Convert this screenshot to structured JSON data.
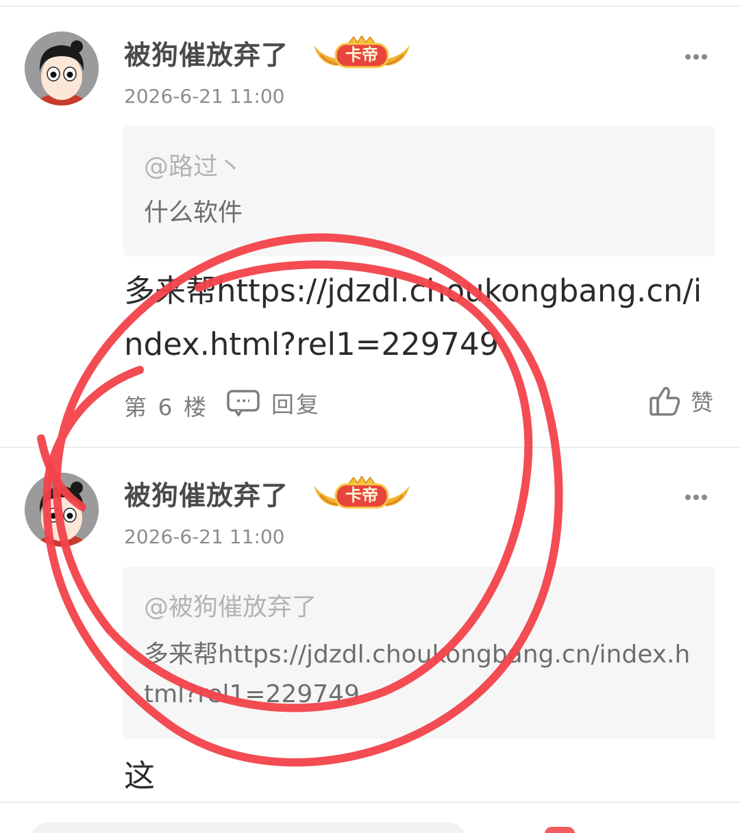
{
  "posts": [
    {
      "username": "被狗催放弃了",
      "badge": "卡帝",
      "timestamp": "2026-6-21 11:00",
      "quote": {
        "mention": "@路过丶",
        "text": "什么软件"
      },
      "body": "多来帮https://jdzdl.choukongbang.cn/index.html?rel1=229749",
      "floor": "第 6 楼",
      "reply_label": "回复",
      "like_label": "赞"
    },
    {
      "username": "被狗催放弃了",
      "badge": "卡帝",
      "timestamp": "2026-6-21 11:00",
      "quote": {
        "mention": "@被狗催放弃了",
        "text": "多来帮https://jdzdl.choukongbang.cn/index.html?rel1=229749"
      },
      "body": "这"
    }
  ],
  "colors": {
    "annotation": "#f2424a",
    "badge_red": "#e8453c",
    "badge_gold": "#f2b233"
  }
}
